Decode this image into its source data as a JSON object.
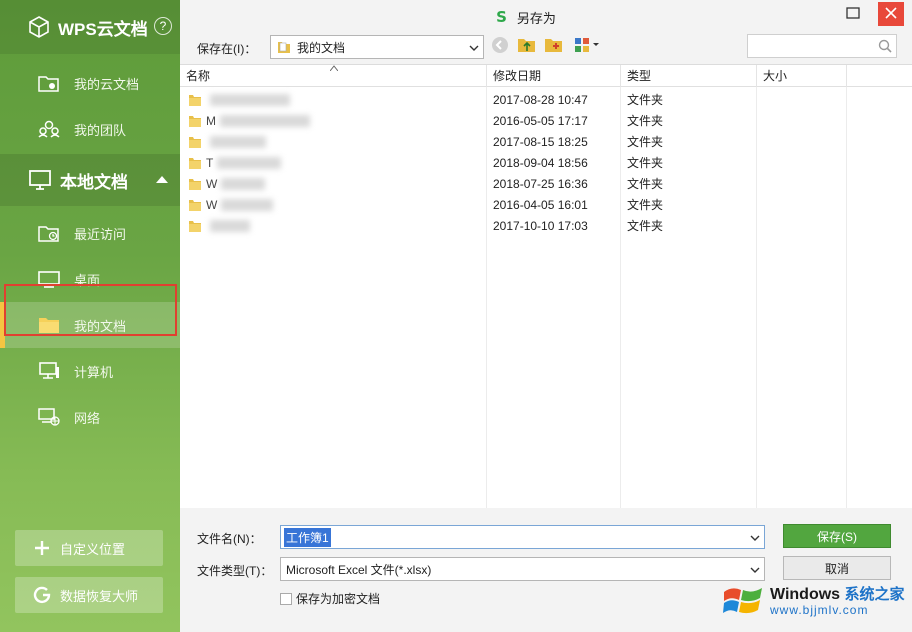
{
  "sidebar": {
    "brand": "WPS云文档",
    "help_icon": "?",
    "cloud_items": [
      {
        "label": "我的云文档",
        "icon": "cloud-folder-icon"
      },
      {
        "label": "我的团队",
        "icon": "team-icon"
      }
    ],
    "local_section": {
      "label": "本地文档",
      "icon": "monitor-icon"
    },
    "local_items": [
      {
        "label": "最近访问",
        "icon": "recent-folder-icon"
      },
      {
        "label": "桌面",
        "icon": "desktop-icon"
      },
      {
        "label": "我的文档",
        "icon": "folder-icon"
      },
      {
        "label": "计算机",
        "icon": "computer-icon"
      },
      {
        "label": "网络",
        "icon": "network-icon"
      }
    ],
    "buttons": [
      {
        "label": "自定义位置",
        "icon": "plus-icon"
      },
      {
        "label": "数据恢复大师",
        "icon": "recovery-icon"
      }
    ]
  },
  "dialog": {
    "title": "另存为",
    "title_logo": "S",
    "save_in_label": "保存在(I)：",
    "save_in_value": "我的文档",
    "search_placeholder": "",
    "columns": [
      "名称",
      "修改日期",
      "类型",
      "大小"
    ],
    "rows": [
      {
        "name": "",
        "date": "2017-08-28 10:47",
        "type": "文件夹"
      },
      {
        "name": "M",
        "date": "2016-05-05 17:17",
        "type": "文件夹"
      },
      {
        "name": "",
        "date": "2017-08-15 18:25",
        "type": "文件夹"
      },
      {
        "name": "T",
        "date": "2018-09-04 18:56",
        "type": "文件夹"
      },
      {
        "name": "W",
        "date": "2018-07-25 16:36",
        "type": "文件夹"
      },
      {
        "name": "W",
        "date": "2016-04-05 16:01",
        "type": "文件夹"
      },
      {
        "name": "",
        "date": "2017-10-10 17:03",
        "type": "文件夹"
      }
    ],
    "filename_label": "文件名(N)：",
    "filename_value": "工作簿1",
    "filetype_label": "文件类型(T)：",
    "filetype_value": "Microsoft Excel 文件(*.xlsx)",
    "encrypt_label": "保存为加密文档",
    "encrypt_checked": false,
    "save_button": "保存(S)",
    "cancel_button": "取消"
  },
  "watermark": {
    "line1": "Windows",
    "line1_cn": "系统之家",
    "line2": "www.bjjmlv.com"
  },
  "colors": {
    "accent_green": "#52a63f",
    "close_red": "#e8483a",
    "selection_blue": "#3875d7",
    "highlight_box": "#e04030"
  }
}
